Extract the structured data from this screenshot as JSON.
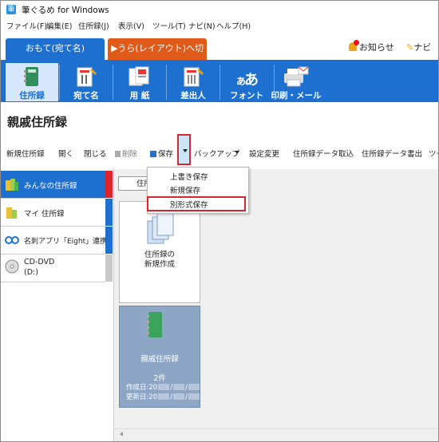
{
  "window": {
    "title": "筆ぐるめ for Windows"
  },
  "menu": [
    "ファイル(F)",
    "編集(E)",
    "住所録(J)",
    "表示(V)",
    "ツール(T)",
    "ナビ(N)",
    "ヘルプ(H)"
  ],
  "tabs": {
    "front": "おもて(宛て名)",
    "back": "▶うら(レイアウト)へ切替"
  },
  "header_links": {
    "notice": "お知らせ",
    "navi": "ナビ"
  },
  "ribbon": [
    "住所録",
    "宛て名",
    "用 紙",
    "差出人",
    "フォント",
    "印刷・メール"
  ],
  "page_title": "親戚住所録",
  "toolbar": {
    "new": "新規住所録",
    "open": "開く",
    "close": "閉じる",
    "delete": "削除",
    "save": "保存",
    "backup": "バックアップ",
    "settings": "設定変更",
    "import": "住所録データ取込",
    "export": "住所録データ書出",
    "tool": "ツー"
  },
  "save_menu": [
    "上書き保存",
    "新規保存",
    "別形式保存"
  ],
  "left_pane": [
    "みんなの住所録",
    "マイ 住所録",
    "名刺アプリ「Eight」連携",
    "CD-DVD",
    "(D:)"
  ],
  "right_header": "住所",
  "card_new": {
    "line1": "住所録の",
    "line2": "新規作成"
  },
  "card_book": {
    "name": "親戚住所録",
    "count": "2件",
    "created": "作成日:20",
    "updated": "更新日:20"
  },
  "colors": {
    "accent": "#1d6fd0",
    "orange": "#e05b1a",
    "highlight": "#d9262c"
  }
}
